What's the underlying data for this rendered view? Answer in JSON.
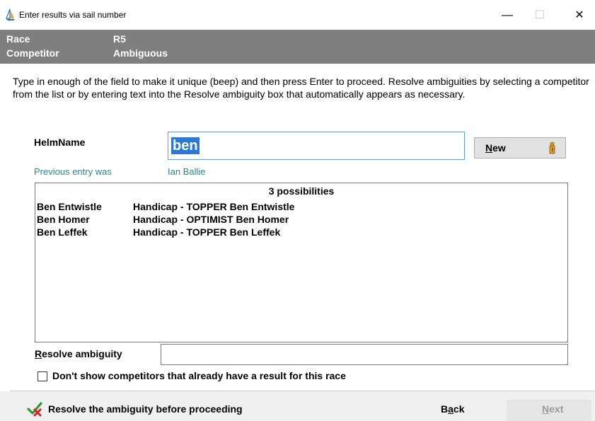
{
  "window": {
    "title": "Enter results via sail number",
    "minimize": "—",
    "maximize": "☐",
    "close": "✕"
  },
  "header": {
    "race_label": "Race",
    "race_value": "R5",
    "competitor_label": "Competitor",
    "competitor_value": "Ambiguous"
  },
  "instructions": "Type in enough of the field to make it unique (beep) and then press Enter to proceed. Resolve ambiguities by selecting a competitor from the list or by entering text into the Resolve ambiguity box that automatically appears as necessary.",
  "helm": {
    "label": "HelmName",
    "value": "ben",
    "new_button_accel": "N",
    "new_button_rest": "ew"
  },
  "previous": {
    "label": "Previous entry was",
    "value": "Ian Ballie"
  },
  "list": {
    "header": "3 possibilities",
    "rows": [
      {
        "name": "Ben Entwistle",
        "detail": "Handicap - TOPPER Ben Entwistle"
      },
      {
        "name": "Ben Homer",
        "detail": "Handicap - OPTIMIST Ben Homer"
      },
      {
        "name": "Ben Leffek",
        "detail": "Handicap - TOPPER Ben Leffek"
      }
    ]
  },
  "resolve": {
    "label_accel": "R",
    "label_rest": "esolve ambiguity",
    "value": ""
  },
  "filter": {
    "label": "Don't show competitors that already have a result for this race",
    "checked": false
  },
  "footer": {
    "status": "Resolve the ambiguity before proceeding",
    "back_pre": "B",
    "back_accel": "a",
    "back_post": "ck",
    "next_accel": "N",
    "next_rest": "ext"
  },
  "colors": {
    "header_bg": "#7f7f7f",
    "selection": "#2b79d4",
    "teal_text": "#2b8a8a",
    "focus_border": "#4ea3e0"
  }
}
